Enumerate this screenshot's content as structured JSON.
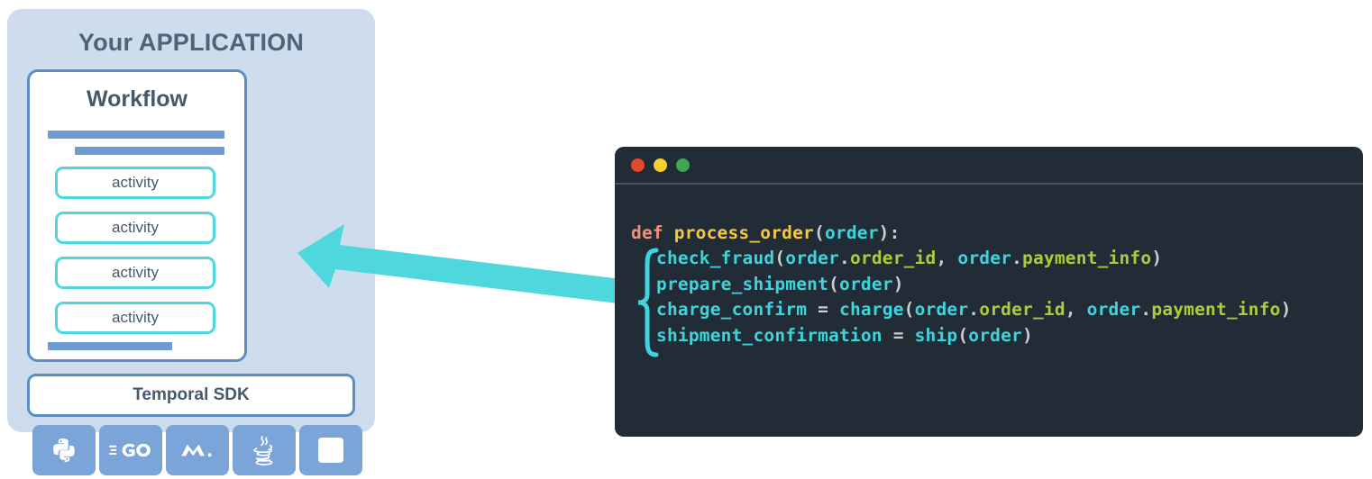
{
  "app_panel": {
    "title": "Your APPLICATION",
    "bg_color": "#CDDDEE",
    "workflow": {
      "title": "Workflow",
      "bar_color": "#6E9BD4",
      "border_color": "#5C8EC6",
      "activity_border_color": "#4FD7DE",
      "activities": [
        {
          "label": "activity"
        },
        {
          "label": "activity"
        },
        {
          "label": "activity"
        },
        {
          "label": "activity"
        }
      ]
    },
    "sdk": {
      "label": "Temporal SDK",
      "tile_color": "#7BA4D8",
      "tiles": [
        {
          "icon": "python-logo-icon",
          "name": "Python"
        },
        {
          "icon": "go-logo-icon",
          "name": "Go"
        },
        {
          "icon": "dotnet-logo-icon",
          "name": ".NET"
        },
        {
          "icon": "java-logo-icon",
          "name": "Java"
        },
        {
          "icon": "blank-square-icon",
          "name": ""
        }
      ]
    }
  },
  "arrow": {
    "icon": "left-arrow-icon",
    "color": "#4FD7DE",
    "direction": "left"
  },
  "code_window": {
    "bg_color": "#222C36",
    "traffic_lights": [
      {
        "name": "close-dot",
        "color": "#E24A2A"
      },
      {
        "name": "minimize-dot",
        "color": "#F5D02E"
      },
      {
        "name": "maximize-dot",
        "color": "#43A554"
      }
    ],
    "brace": {
      "icon": "curly-brace-icon",
      "color": "#3ED4DC"
    },
    "colors": {
      "keyword": "#F2907A",
      "function": "#F5C842",
      "identifier": "#3ED4DC",
      "attribute": "#A8CE3B",
      "punctuation": "#C9CFD4"
    },
    "language": "python",
    "lines": [
      {
        "plain": "def process_order(order):",
        "tokens": [
          {
            "t": "def",
            "c": "t-kw"
          },
          {
            "t": " ",
            "c": "t-punc"
          },
          {
            "t": "process_order",
            "c": "t-fn"
          },
          {
            "t": "(",
            "c": "t-punc"
          },
          {
            "t": "order",
            "c": "t-id"
          },
          {
            "t": "):",
            "c": "t-punc"
          }
        ]
      },
      {
        "plain": "check_fraud(order.order_id, order.payment_info)",
        "tokens": [
          {
            "t": "check_fraud",
            "c": "t-id"
          },
          {
            "t": "(",
            "c": "t-punc"
          },
          {
            "t": "order",
            "c": "t-id"
          },
          {
            "t": ".",
            "c": "t-punc"
          },
          {
            "t": "order_id",
            "c": "t-attr"
          },
          {
            "t": ", ",
            "c": "t-punc"
          },
          {
            "t": "order",
            "c": "t-id"
          },
          {
            "t": ".",
            "c": "t-punc"
          },
          {
            "t": "payment_info",
            "c": "t-attr"
          },
          {
            "t": ")",
            "c": "t-punc"
          }
        ]
      },
      {
        "plain": "prepare_shipment(order)",
        "tokens": [
          {
            "t": "prepare_shipment",
            "c": "t-id"
          },
          {
            "t": "(",
            "c": "t-punc"
          },
          {
            "t": "order",
            "c": "t-id"
          },
          {
            "t": ")",
            "c": "t-punc"
          }
        ]
      },
      {
        "plain": "charge_confirm = charge(order.order_id, order.payment_info)",
        "tokens": [
          {
            "t": "charge_confirm",
            "c": "t-id"
          },
          {
            "t": " = ",
            "c": "t-punc"
          },
          {
            "t": "charge",
            "c": "t-id"
          },
          {
            "t": "(",
            "c": "t-punc"
          },
          {
            "t": "order",
            "c": "t-id"
          },
          {
            "t": ".",
            "c": "t-punc"
          },
          {
            "t": "order_id",
            "c": "t-attr"
          },
          {
            "t": ", ",
            "c": "t-punc"
          },
          {
            "t": "order",
            "c": "t-id"
          },
          {
            "t": ".",
            "c": "t-punc"
          },
          {
            "t": "payment_info",
            "c": "t-attr"
          },
          {
            "t": ")",
            "c": "t-punc"
          }
        ]
      },
      {
        "plain": "shipment_confirmation = ship(order)",
        "tokens": [
          {
            "t": "shipment_confirmation",
            "c": "t-id"
          },
          {
            "t": " = ",
            "c": "t-punc"
          },
          {
            "t": "ship",
            "c": "t-id"
          },
          {
            "t": "(",
            "c": "t-punc"
          },
          {
            "t": "order",
            "c": "t-id"
          },
          {
            "t": ")",
            "c": "t-punc"
          }
        ]
      }
    ]
  }
}
